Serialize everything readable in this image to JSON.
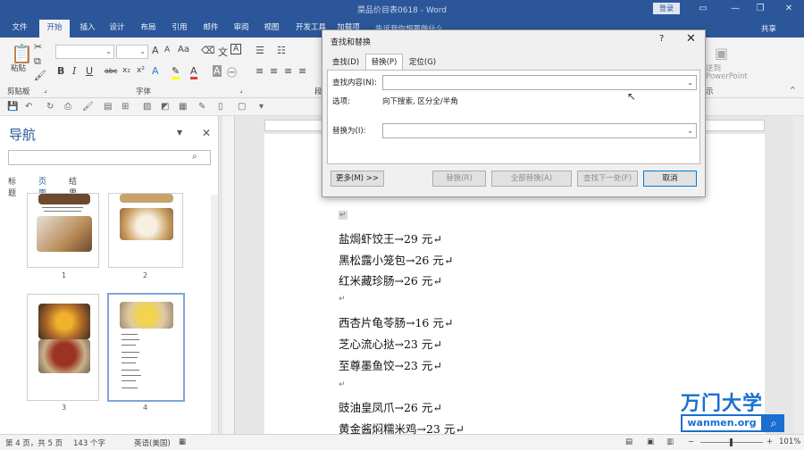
{
  "window": {
    "title": "菜品价目表0618 - Word",
    "login": "登录",
    "minimize_icon": "—",
    "restore_icon": "❐",
    "ribbon_toggle_icon": "▭",
    "close_icon": "✕"
  },
  "tabs": [
    "文件",
    "开始",
    "插入",
    "设计",
    "布局",
    "引用",
    "邮件",
    "审阅",
    "视图",
    "开发工具",
    "加载项"
  ],
  "tell_me": "告诉我你想要做什么",
  "share": "共享",
  "ribbon": {
    "paste": "粘贴",
    "clipboard": "剪贴板",
    "font": "字体",
    "font_increase": "A",
    "font_decrease": "A",
    "aa": "Aa",
    "bold": "B",
    "italic": "I",
    "underline": "U",
    "strike": "abc",
    "subscript": "x₂",
    "superscript": "x²",
    "font_color": "A",
    "char_shade": "A",
    "send_to": "送到",
    "powerpoint": "PowerPoint",
    "show": "示"
  },
  "nav": {
    "title": "导航",
    "tabs": [
      "标题",
      "页面",
      "结果"
    ],
    "page_numbers": [
      "1",
      "2",
      "3",
      "4"
    ]
  },
  "document": {
    "lines": [
      "盐焗虾饺王→29 元↵",
      "黑松露小笼包→26 元↵",
      "红米藏珍肠→26 元↵",
      "↵",
      "西杏片龟苓肠→16 元↵",
      "芝心流心挞→23 元↵",
      "至尊墨鱼饺→23 元↵",
      "↵",
      "豉油皇凤爪→26 元↵",
      "黄金酱焖糯米鸡→23 元↵"
    ],
    "top_mark": "↵"
  },
  "dialog": {
    "title": "查找和替换",
    "help": "?",
    "close": "✕",
    "tabs": [
      "查找(D)",
      "替换(P)",
      "定位(G)"
    ],
    "find_label": "查找内容(N):",
    "options_label": "选项:",
    "options_value": "向下搜索, 区分全/半角",
    "replace_label": "替换为(I):",
    "buttons": {
      "more": "更多(M) >>",
      "replace": "替换(R)",
      "replace_all": "全部替换(A)",
      "find_next": "查找下一处(F)",
      "cancel": "取消"
    }
  },
  "status": {
    "page": "第 4 页，共 5 页",
    "words": "143 个字",
    "lang": "英语(美国)",
    "zoom": "101%"
  },
  "watermark": {
    "brand": "万门大学",
    "url": "wanmen.org"
  }
}
